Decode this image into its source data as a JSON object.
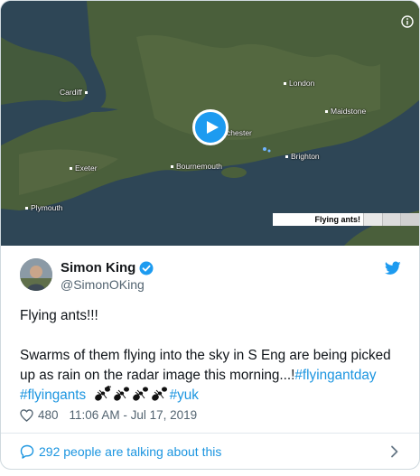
{
  "media": {
    "cities": [
      {
        "name": "London"
      },
      {
        "name": "Cardiff"
      },
      {
        "name": "Maidstone"
      },
      {
        "name": "chester"
      },
      {
        "name": "Brighton"
      },
      {
        "name": "Exeter"
      },
      {
        "name": "Bournemouth"
      },
      {
        "name": "Plymouth"
      }
    ],
    "legend_label": "Flying ants!",
    "play_icon": "play-icon",
    "info_icon": "info-icon"
  },
  "tweet": {
    "display_name": "Simon King",
    "handle": "@SimonOKing",
    "line1": "Flying ants!!!",
    "line2": "Swarms of them flying into the sky in S Eng are being picked up as rain on the radar image this morning...!",
    "hashtags": [
      "#flyingantday",
      "#flyingants"
    ],
    "trailing_hashtag": "#yuk",
    "emoji_name": "ant-emoji",
    "emoji_count": 4,
    "likes": "480",
    "timestamp": "11:06 AM - Jul 17, 2019",
    "talking": "292 people are talking about this"
  },
  "colors": {
    "link": "#1b95e0",
    "play": "#1d9bf0",
    "sea": "#2f4858",
    "land": "#3f5a3a"
  }
}
